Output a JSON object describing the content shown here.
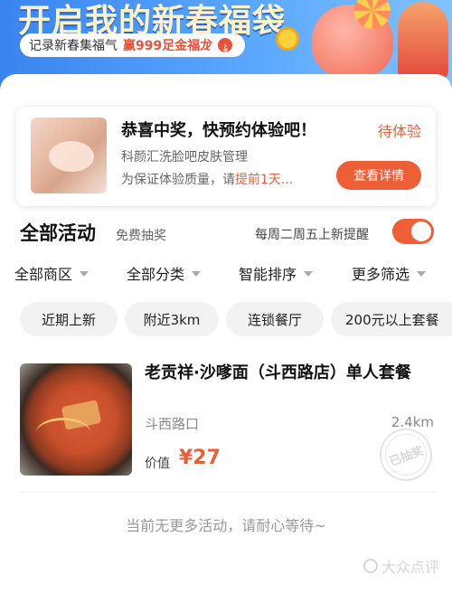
{
  "banner": {
    "title": "开启我的新春福袋",
    "subtitle_prefix": "记录新春集福气",
    "subtitle_highlight": "赢999足金福龙",
    "arrow": "›"
  },
  "prize": {
    "title": "恭喜中奖，快预约体验吧！",
    "status": "待体验",
    "shop": "科颜汇洗脸吧皮肤管理",
    "note_prefix": "为保证体验质量，请",
    "note_highlight": "提前1天...",
    "button": "查看详情"
  },
  "section": {
    "title": "全部活动",
    "subtitle": "免费抽奖",
    "reminder": "每周二周五上新提醒",
    "reminder_on": true
  },
  "filters": [
    "全部商区",
    "全部分类",
    "智能排序",
    "更多筛选"
  ],
  "chips": [
    "近期上新",
    "附近3km",
    "连锁餐厅",
    "200元以上套餐"
  ],
  "deal": {
    "title": "老贡祥·沙嗲面（斗西路店）单人套餐",
    "location": "斗西路口",
    "distance": "2.4km",
    "price_label": "价值",
    "price": "¥27",
    "stamp": "已抽奖"
  },
  "footer": {
    "no_more": "当前无更多活动，请耐心等待~",
    "watermark": "大众点评"
  },
  "colors": {
    "accent": "#ee5f38",
    "banner": "#4a95f5"
  }
}
